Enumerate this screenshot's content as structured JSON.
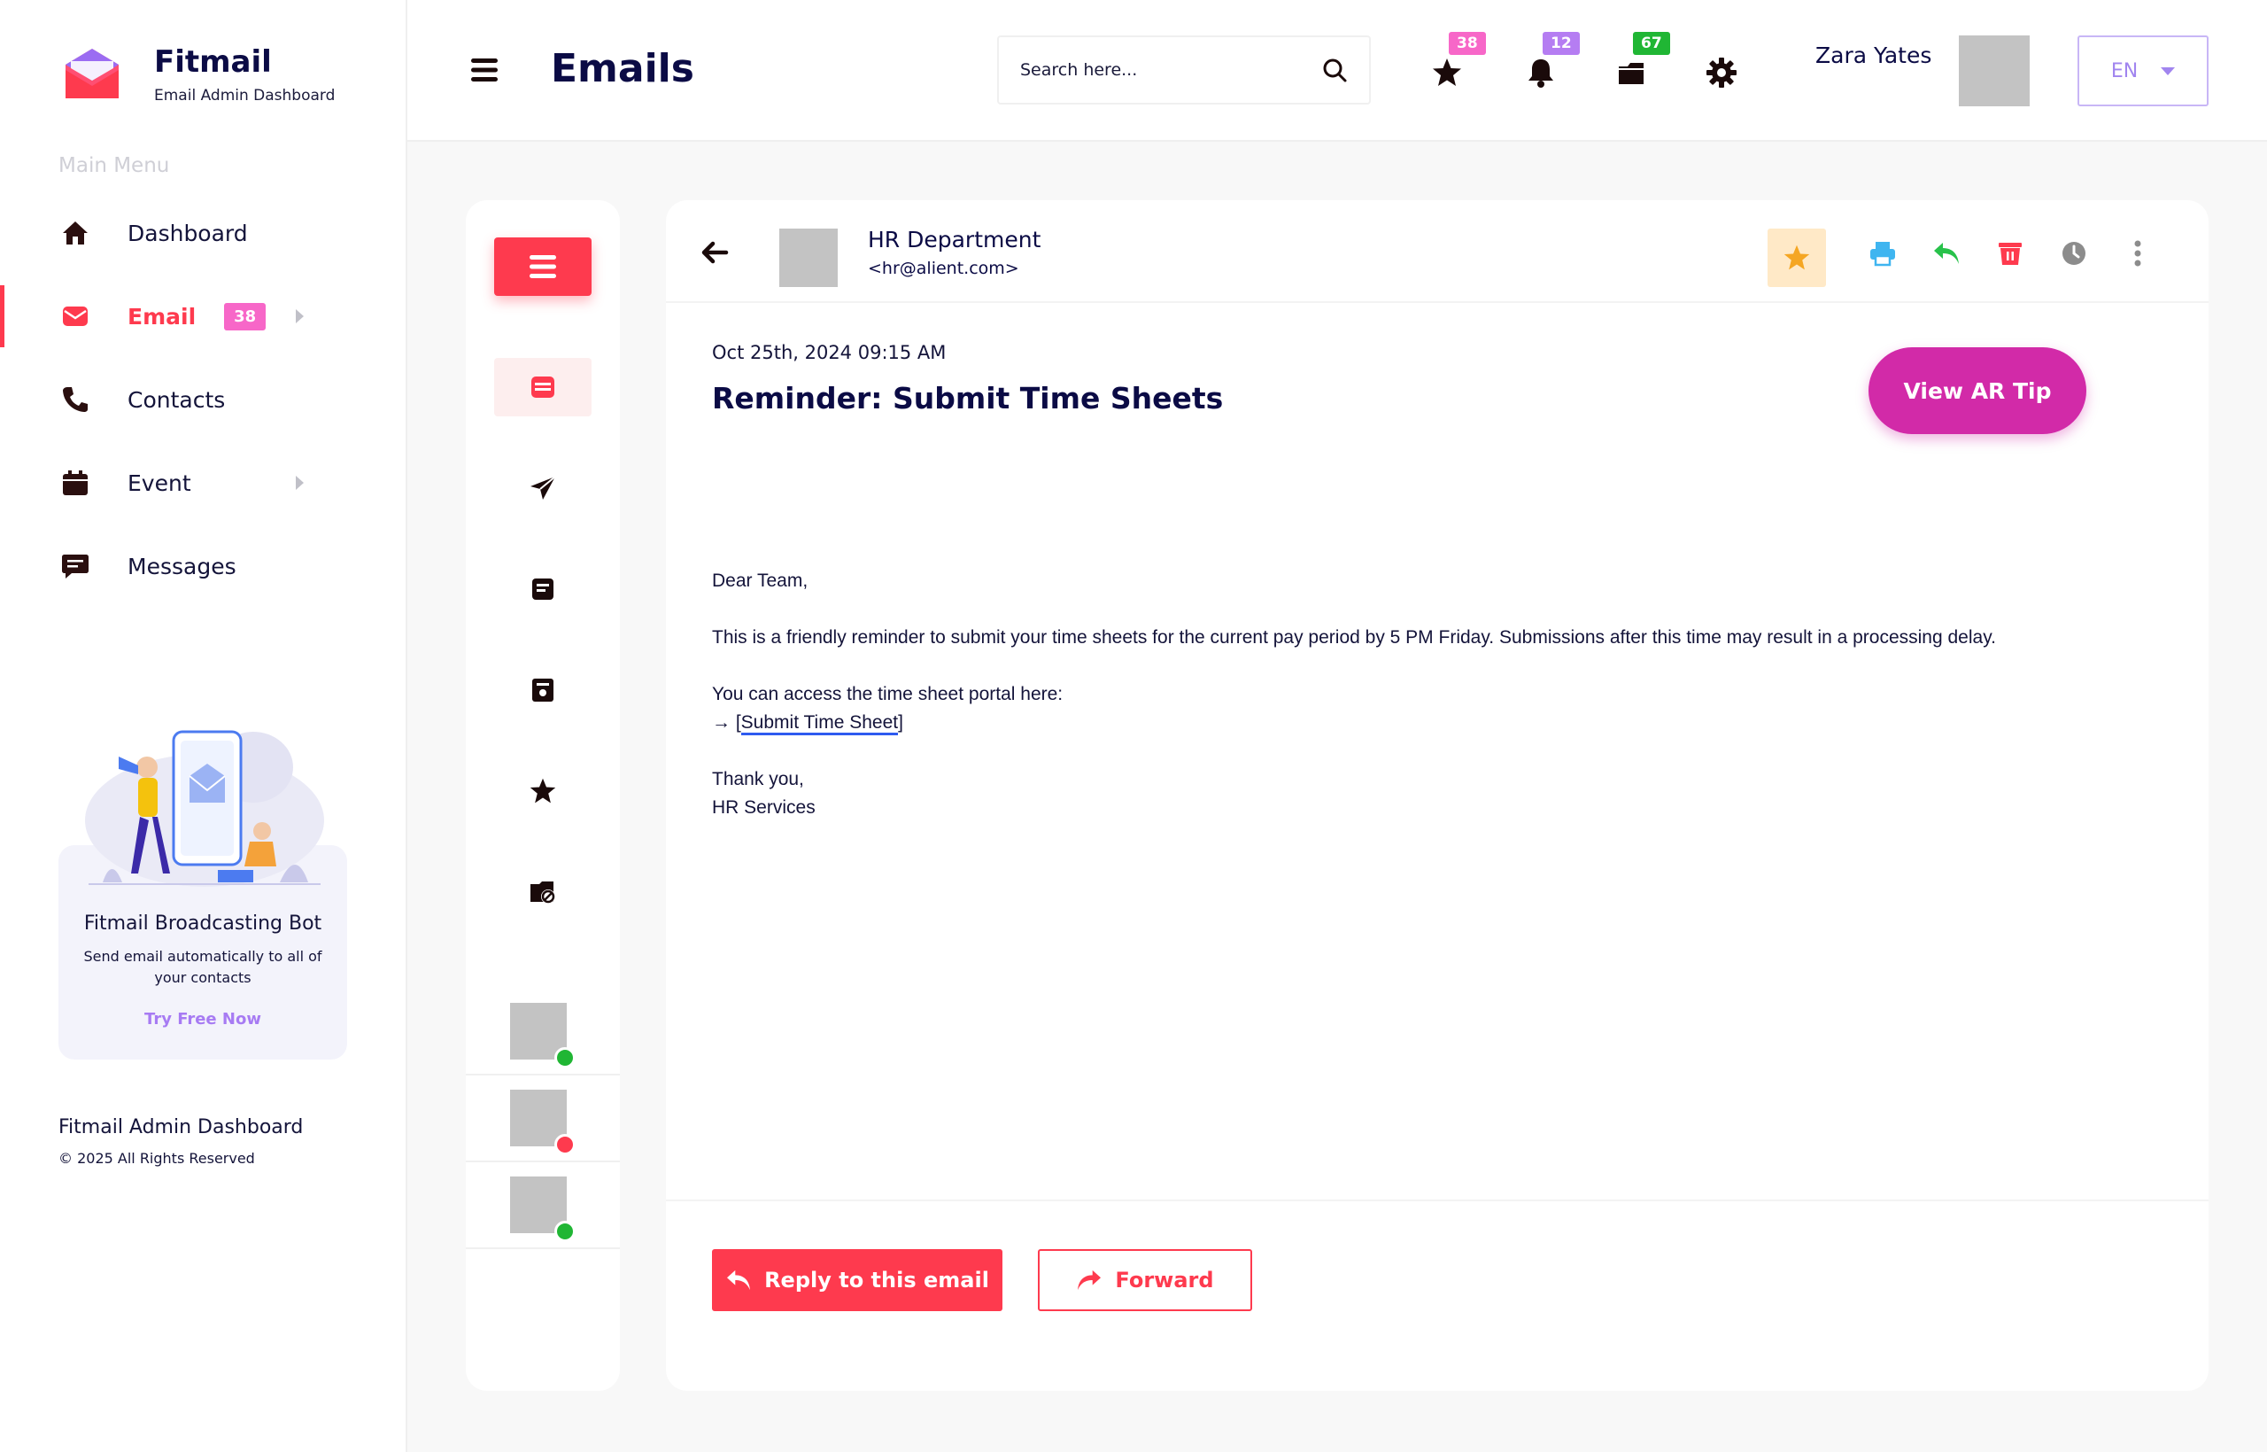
{
  "brand": {
    "name": "Fitmail",
    "subtitle": "Email Admin Dashboard"
  },
  "sidebar": {
    "heading": "Main Menu",
    "items": [
      {
        "label": "Dashboard",
        "icon": "home-icon"
      },
      {
        "label": "Email",
        "icon": "envelope-icon",
        "badge": "38",
        "active": true
      },
      {
        "label": "Contacts",
        "icon": "phone-icon"
      },
      {
        "label": "Event",
        "icon": "calendar-icon"
      },
      {
        "label": "Messages",
        "icon": "chat-icon"
      }
    ],
    "promo": {
      "title": "Fitmail Broadcasting Bot",
      "description": "Send email automatically to all of your contacts",
      "cta": "Try Free Now"
    },
    "footer": {
      "title": "Fitmail Admin Dashboard",
      "copyright": "© 2025 All Rights Reserved"
    }
  },
  "header": {
    "title": "Emails",
    "search_placeholder": "Search here...",
    "badges": {
      "favorites": "38",
      "notifications": "12",
      "inbox": "67"
    },
    "user_name": "Zara Yates",
    "language": "EN"
  },
  "email": {
    "sender_name": "HR Department",
    "sender_email": "<hr@alient.com>",
    "date": "Oct 25th, 2024  09:15 AM",
    "subject": "Reminder: Submit Time Sheets",
    "ar_tip_label": "View AR Tip",
    "greeting": "Dear Team,",
    "paragraph": "This is a friendly reminder to submit your time sheets for the current pay period by 5 PM Friday. Submissions after this time may result in a processing delay.",
    "portal_line": "You can access the time sheet portal here:",
    "link_prefix": "→ [",
    "link_text": "Submit Time Sheet",
    "link_suffix": "]",
    "signoff": "Thank you,",
    "signature": "HR Services",
    "reply_label": "Reply to this email",
    "forward_label": "Forward"
  },
  "colors": {
    "accent": "#fe3a4e",
    "navy": "#0b0b45",
    "badge_pink": "#f767c8",
    "badge_purple": "#b57df2",
    "badge_green": "#20b634",
    "ar_tip": "#d22aa8",
    "status_online": "#20b634",
    "status_busy": "#fe3a4e"
  }
}
